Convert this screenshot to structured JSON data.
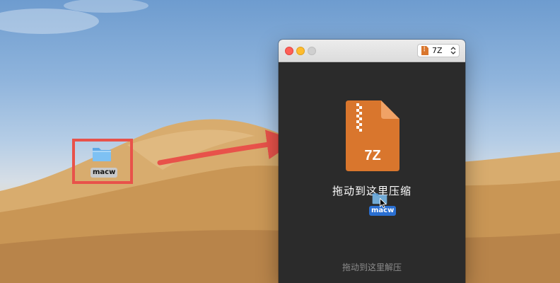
{
  "desktop": {
    "folder_label": "macw",
    "folder_icon": "folder-icon"
  },
  "window": {
    "format_selector": {
      "value": "7Z",
      "icon": "archive-file-icon"
    },
    "archive_badge": "7Z",
    "compress_hint": "拖动到这里压缩",
    "drag_label": "macw",
    "extract_hint": "拖动到这里解压"
  },
  "colors": {
    "highlight_red": "#e8524a",
    "archive_orange": "#d9762d",
    "window_bg": "#2b2b2b",
    "drag_label_blue": "#2a6fd1"
  }
}
